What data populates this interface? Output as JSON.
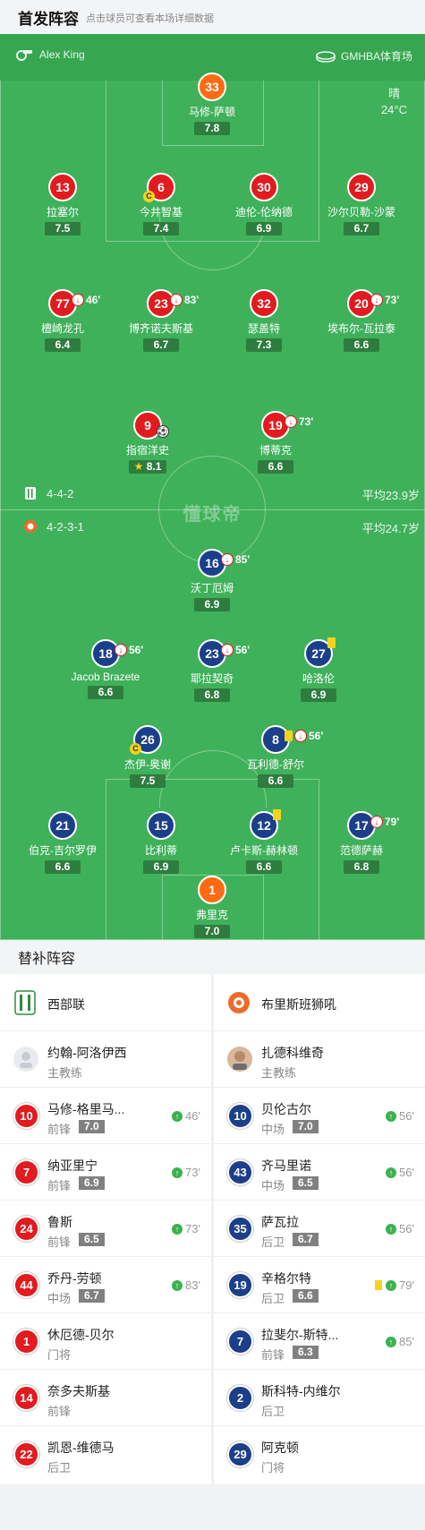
{
  "header": {
    "title": "首发阵容",
    "subtitle": "点击球员可查看本场详细数据"
  },
  "match": {
    "referee": "Alex King",
    "venue": "GMHBA体育场",
    "weather": "晴",
    "temperature": "24°C",
    "watermark": "懂球帝"
  },
  "home": {
    "formation": "4-4-2",
    "avg_age": "平均23.9岁",
    "color": "#e11b1f",
    "players": [
      {
        "num": "33",
        "name": "马修-萨顿",
        "rating": "7.8"
      },
      {
        "num": "13",
        "name": "拉塞尔",
        "rating": "7.5"
      },
      {
        "num": "6",
        "name": "今井智基",
        "rating": "7.4",
        "captain": "C"
      },
      {
        "num": "30",
        "name": "迪伦-伦纳德",
        "rating": "6.9"
      },
      {
        "num": "29",
        "name": "沙尔贝勒-沙蒙",
        "rating": "6.7"
      },
      {
        "num": "77",
        "name": "檀崎龙孔",
        "rating": "6.4",
        "sub_min": "46'"
      },
      {
        "num": "23",
        "name": "博齐诺夫斯基",
        "rating": "6.7",
        "sub_min": "83'"
      },
      {
        "num": "32",
        "name": "瑟盖特",
        "rating": "7.3"
      },
      {
        "num": "20",
        "name": "埃布尔-瓦拉泰",
        "rating": "6.6",
        "sub_min": "73'"
      },
      {
        "num": "9",
        "name": "指宿洋史",
        "rating": "8.1"
      },
      {
        "num": "19",
        "name": "博蒂克",
        "rating": "6.6",
        "sub_min": "73'"
      }
    ]
  },
  "away": {
    "formation": "4-2-3-1",
    "avg_age": "平均24.7岁",
    "color": "#1c3f8a",
    "players": [
      {
        "num": "16",
        "name": "沃丁厄姆",
        "rating": "6.9",
        "sub_min": "85'"
      },
      {
        "num": "18",
        "name": "Jacob Brazete",
        "rating": "6.6",
        "sub_min": "56'"
      },
      {
        "num": "23",
        "name": "耶拉契奇",
        "rating": "6.8",
        "sub_min": "56'"
      },
      {
        "num": "27",
        "name": "哈洛伦",
        "rating": "6.9"
      },
      {
        "num": "26",
        "name": "杰伊-奥谢",
        "rating": "7.5",
        "captain": "C"
      },
      {
        "num": "8",
        "name": "瓦利德-舒尔",
        "rating": "6.6",
        "sub_min": "56'"
      },
      {
        "num": "21",
        "name": "伯克-吉尔罗伊",
        "rating": "6.6"
      },
      {
        "num": "15",
        "name": "比利蒂",
        "rating": "6.9"
      },
      {
        "num": "12",
        "name": "卢卡斯-赫林顿",
        "rating": "6.6"
      },
      {
        "num": "17",
        "name": "范德萨赫",
        "rating": "6.8",
        "sub_min": "79'"
      },
      {
        "num": "1",
        "name": "弗里克",
        "rating": "7.0"
      }
    ]
  },
  "substitutes": {
    "title": "替补阵容",
    "home": {
      "team": "西部联",
      "coach": {
        "name": "约翰-阿洛伊西",
        "role": "主教练"
      },
      "list": [
        {
          "num": "10",
          "name": "马修-格里马...",
          "pos": "前锋",
          "rating": "7.0",
          "in": "46'"
        },
        {
          "num": "7",
          "name": "纳亚里宁",
          "pos": "前锋",
          "rating": "6.9",
          "in": "73'"
        },
        {
          "num": "24",
          "name": "鲁斯",
          "pos": "前锋",
          "rating": "6.5",
          "in": "73'"
        },
        {
          "num": "44",
          "name": "乔丹-劳顿",
          "pos": "中场",
          "rating": "6.7",
          "in": "83'"
        },
        {
          "num": "1",
          "name": "休厄德-贝尔",
          "pos": "门将"
        },
        {
          "num": "14",
          "name": "奈多夫斯基",
          "pos": "前锋"
        },
        {
          "num": "22",
          "name": "凯恩-维德马",
          "pos": "后卫"
        }
      ]
    },
    "away": {
      "team": "布里斯班狮吼",
      "coach": {
        "name": "扎德科维奇",
        "role": "主教练"
      },
      "list": [
        {
          "num": "10",
          "name": "贝伦古尔",
          "pos": "中场",
          "rating": "7.0",
          "in": "56'"
        },
        {
          "num": "43",
          "name": "齐马里诺",
          "pos": "中场",
          "rating": "6.5",
          "in": "56'"
        },
        {
          "num": "35",
          "name": "萨瓦拉",
          "pos": "后卫",
          "rating": "6.7",
          "in": "56'"
        },
        {
          "num": "19",
          "name": "辛格尔特",
          "pos": "后卫",
          "rating": "6.6",
          "in": "79'"
        },
        {
          "num": "7",
          "name": "拉斐尔-斯特...",
          "pos": "前锋",
          "rating": "6.3",
          "in": "85'"
        },
        {
          "num": "2",
          "name": "斯科特-内维尔",
          "pos": "后卫"
        },
        {
          "num": "29",
          "name": "阿克顿",
          "pos": "门将"
        }
      ]
    }
  },
  "icons": {
    "sub_out": "substitution-out-icon",
    "sub_in": "substitution-in-icon",
    "yellow_card": "yellow-card-icon",
    "goal": "football-icon",
    "mvp": "star-icon",
    "referee": "whistle-icon",
    "venue": "stadium-icon"
  }
}
